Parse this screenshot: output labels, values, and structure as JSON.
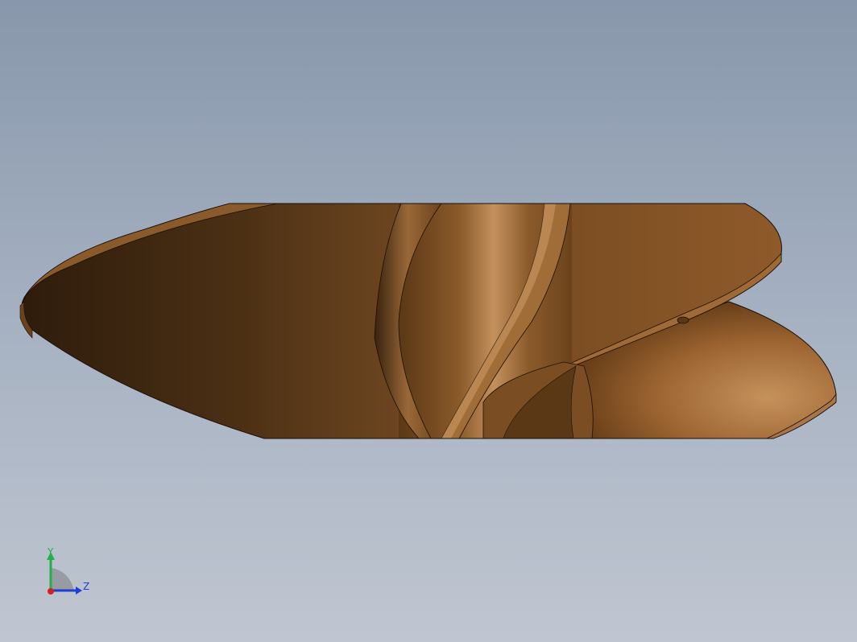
{
  "viewport": {
    "background_top": "#8897ab",
    "background_bottom": "#c0c6d1"
  },
  "model": {
    "name": "propeller-blade-model",
    "colors": {
      "dark": "#2b1a0d",
      "mid": "#6b4320",
      "light": "#b5824e",
      "highlight": "#d9a877",
      "edge": "#1a0f06"
    }
  },
  "triad": {
    "y_label": "Y",
    "z_label": "Z",
    "y_color": "#22b04a",
    "z_color": "#1e3fd6",
    "x_color": "#d62020"
  }
}
